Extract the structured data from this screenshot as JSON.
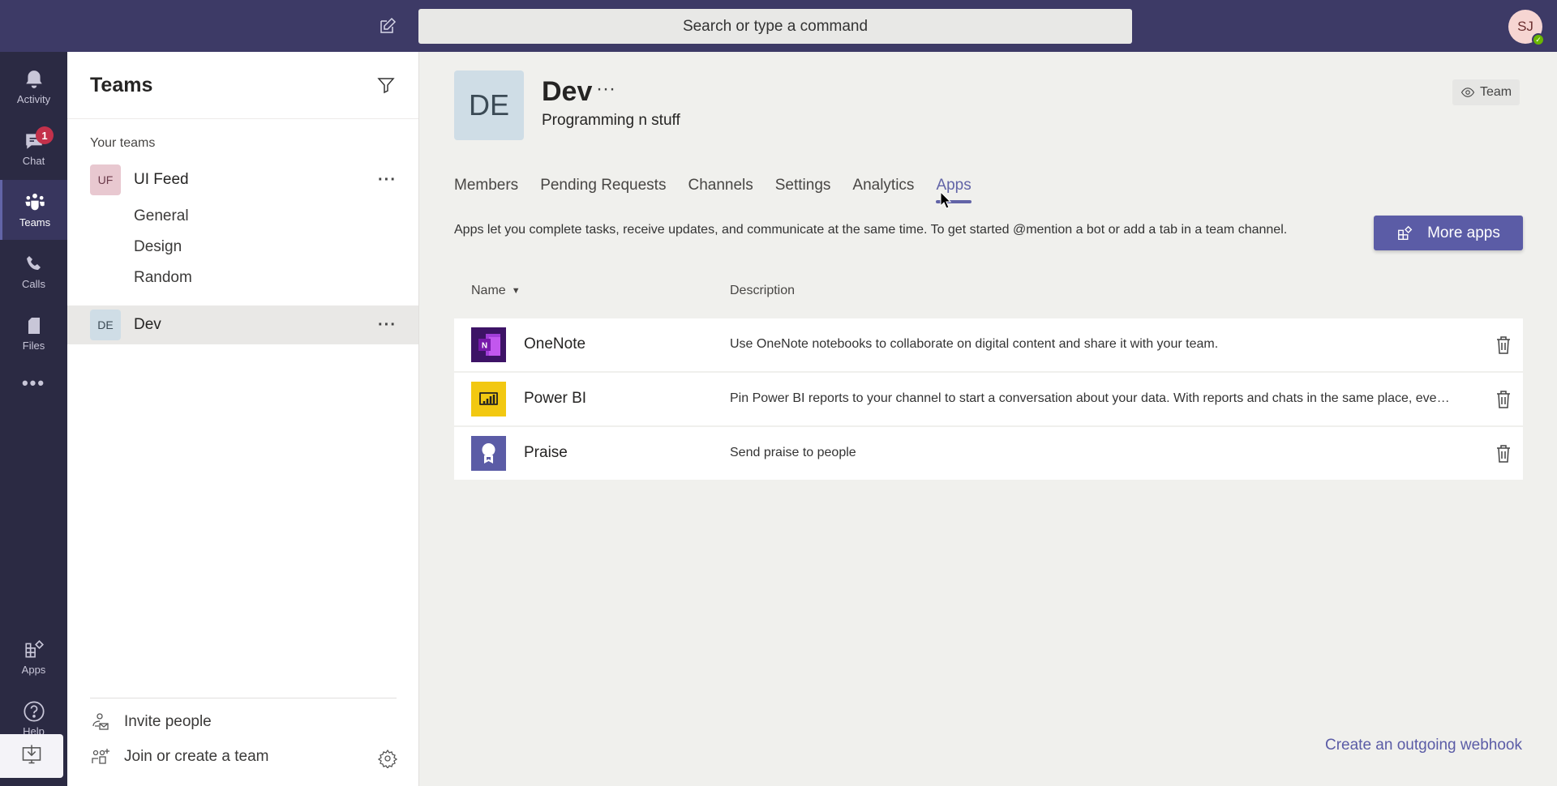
{
  "topbar": {
    "search_placeholder": "Search or type a command",
    "user_initials": "SJ",
    "presence": "available"
  },
  "rail": {
    "items": [
      {
        "label": "Activity",
        "icon": "bell-icon"
      },
      {
        "label": "Chat",
        "icon": "chat-icon",
        "badge": "1"
      },
      {
        "label": "Teams",
        "icon": "teams-icon",
        "active": true
      },
      {
        "label": "Calls",
        "icon": "phone-icon"
      },
      {
        "label": "Files",
        "icon": "file-icon"
      },
      {
        "label": "",
        "icon": "more-icon"
      },
      {
        "label": "Apps",
        "icon": "apps-icon"
      },
      {
        "label": "Help",
        "icon": "help-icon"
      }
    ],
    "download_icon": "download-icon"
  },
  "teams_panel": {
    "title": "Teams",
    "section_label": "Your teams",
    "teams": [
      {
        "initials": "UF",
        "name": "UI Feed",
        "color": "#e8c8d0",
        "channels": [
          "General",
          "Design",
          "Random"
        ]
      },
      {
        "initials": "DE",
        "name": "Dev",
        "color": "#cfdde6",
        "selected": true
      }
    ],
    "invite_label": "Invite people",
    "join_label": "Join or create a team"
  },
  "main": {
    "team_initials": "DE",
    "team_name": "Dev",
    "team_description": "Programming n stuff",
    "visibility_label": "Team",
    "tabs": [
      "Members",
      "Pending Requests",
      "Channels",
      "Settings",
      "Analytics",
      "Apps"
    ],
    "active_tab": "Apps",
    "intro": "Apps let you complete tasks, receive updates, and communicate at the same time. To get started @mention a bot or add a tab in a team channel.",
    "more_apps_label": "More apps",
    "columns": {
      "name": "Name",
      "description": "Description"
    },
    "apps": [
      {
        "name": "OneNote",
        "description": "Use OneNote notebooks to collaborate on digital content and share it with your team.",
        "icon_color": "#7719aa"
      },
      {
        "name": "Power BI",
        "description": "Pin Power BI reports to your channel to start a conversation about your data. With reports and chats in the same place, everyone stays on the same page.",
        "icon_color": "#f2c811"
      },
      {
        "name": "Praise",
        "description": "Send praise to people",
        "icon_color": "#5b5ca6"
      }
    ],
    "webhook_link": "Create an outgoing webhook"
  },
  "colors": {
    "brand": "#6264a7",
    "topbar": "#3d3a66",
    "rail": "#2b2a43"
  }
}
